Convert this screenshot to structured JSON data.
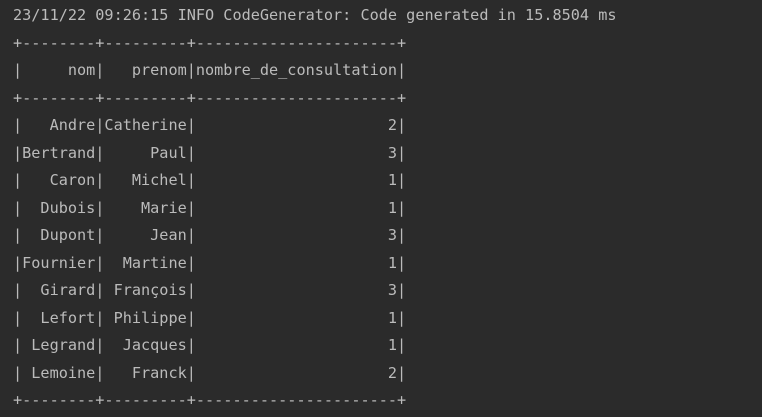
{
  "console": {
    "log_line": "23/11/22 09:26:15 INFO CodeGenerator: Code generated in 15.8504 ms",
    "border": "+--------+---------+----------------------+",
    "header_row": "|     nom|   prenom|nombre_de_consultation|",
    "rows": [
      "|   Andre|Catherine|                     2|",
      "|Bertrand|     Paul|                     3|",
      "|   Caron|   Michel|                     1|",
      "|  Dubois|    Marie|                     1|",
      "|  Dupont|     Jean|                     3|",
      "|Fournier|  Martine|                     1|",
      "|  Girard| François|                     3|",
      "|  Lefort| Philippe|                     1|",
      "| Legrand|  Jacques|                     1|",
      "| Lemoine|   Franck|                     2|"
    ]
  },
  "table": {
    "columns": [
      "nom",
      "prenom",
      "nombre_de_consultation"
    ],
    "data": [
      [
        "Andre",
        "Catherine",
        2
      ],
      [
        "Bertrand",
        "Paul",
        3
      ],
      [
        "Caron",
        "Michel",
        1
      ],
      [
        "Dubois",
        "Marie",
        1
      ],
      [
        "Dupont",
        "Jean",
        3
      ],
      [
        "Fournier",
        "Martine",
        1
      ],
      [
        "Girard",
        "François",
        3
      ],
      [
        "Lefort",
        "Philippe",
        1
      ],
      [
        "Legrand",
        "Jacques",
        1
      ],
      [
        "Lemoine",
        "Franck",
        2
      ]
    ]
  },
  "colors": {
    "background": "#2b2b2b",
    "text": "#bbbbbb"
  }
}
